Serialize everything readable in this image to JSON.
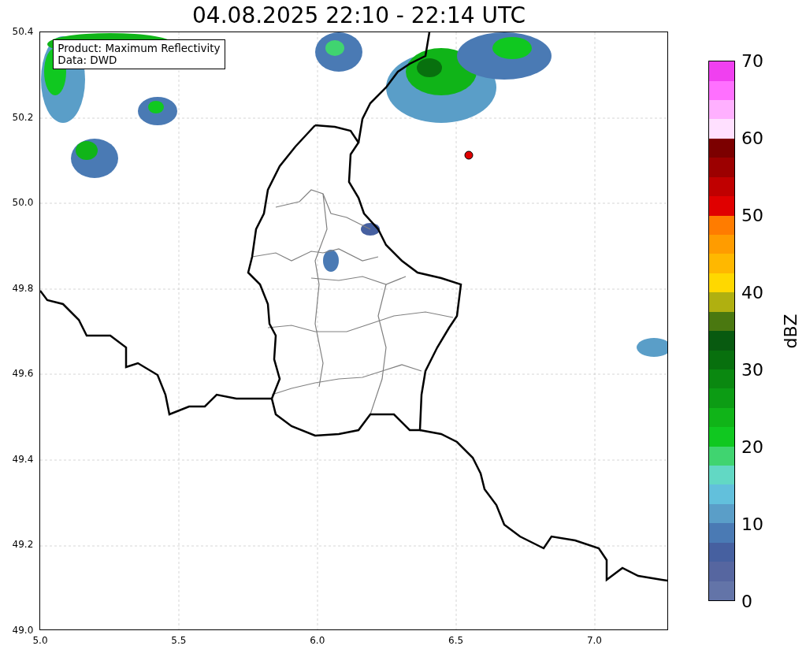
{
  "title": "04.08.2025 22:10 - 22:14 UTC",
  "legend": {
    "lines": [
      "Product: Maximum Reflectivity",
      "Data: DWD"
    ]
  },
  "map": {
    "kind": "map",
    "xticks": [
      "5.0",
      "5.5",
      "6.0",
      "6.5",
      "7.0"
    ],
    "yticks": [
      "50.4",
      "50.2",
      "50.0",
      "49.8",
      "49.6",
      "49.4",
      "49.2",
      "49.0"
    ]
  },
  "colorbar": {
    "label": "dBZ",
    "ticks": [
      "70",
      "60",
      "50",
      "40",
      "30",
      "20",
      "10",
      "0"
    ],
    "segments": [
      {
        "color": "#6374a8"
      },
      {
        "color": "#5666a0"
      },
      {
        "color": "#4660a0"
      },
      {
        "color": "#4a7ab4"
      },
      {
        "color": "#5a9ec8"
      },
      {
        "color": "#62c0dc"
      },
      {
        "color": "#62d8c4"
      },
      {
        "color": "#40d470"
      },
      {
        "color": "#10c820"
      },
      {
        "color": "#10b418"
      },
      {
        "color": "#0c9c14"
      },
      {
        "color": "#0a8810"
      },
      {
        "color": "#08700e"
      },
      {
        "color": "#085a10"
      },
      {
        "color": "#4a7810"
      },
      {
        "color": "#b0b010"
      },
      {
        "color": "#ffd800"
      },
      {
        "color": "#ffb800"
      },
      {
        "color": "#ff9c00"
      },
      {
        "color": "#ff7c00"
      },
      {
        "color": "#e00000"
      },
      {
        "color": "#c00000"
      },
      {
        "color": "#9c0000"
      },
      {
        "color": "#7c0000"
      },
      {
        "color": "#ffe0ff"
      },
      {
        "color": "#ffb0ff"
      },
      {
        "color": "#ff70ff"
      },
      {
        "color": "#f040f0"
      }
    ]
  }
}
